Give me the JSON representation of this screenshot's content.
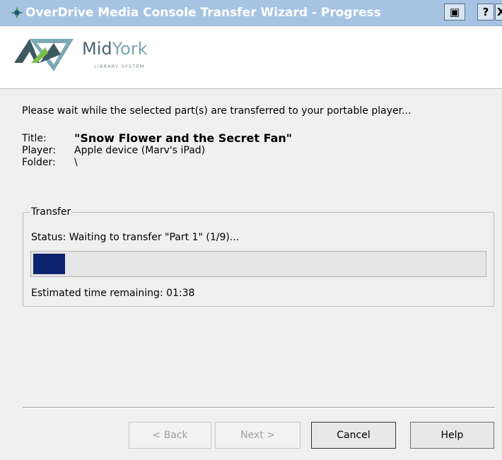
{
  "window": {
    "title": "OverDrive Media Console Transfer Wizard - Progress",
    "restore_label": "▣",
    "help_label": "?",
    "close_label": "X"
  },
  "logo": {
    "name_mid": "Mid",
    "name_york": "York",
    "subtitle": "LIBRARY SYSTEM",
    "colors": {
      "dark": "#3f5961",
      "light": "#7aa8b5",
      "green": "#7bbf4a"
    }
  },
  "intro": "Please wait while the selected part(s) are transferred to your portable player...",
  "details": {
    "title_label": "Title:",
    "title_value": "\"Snow Flower and the Secret Fan\"",
    "player_label": "Player:",
    "player_value": "Apple device (Marv's iPad)",
    "folder_label": "Folder:",
    "folder_value": "\\"
  },
  "transfer": {
    "group_label": "Transfer",
    "status": "Status: Waiting to transfer \"Part 1\" (1/9)...",
    "progress_fraction": 0.07,
    "progress_color": "#0c2470",
    "estimate": "Estimated time remaining: 01:38"
  },
  "buttons": {
    "back": "< Back",
    "next": "Next >",
    "cancel": "Cancel",
    "help": "Help"
  }
}
